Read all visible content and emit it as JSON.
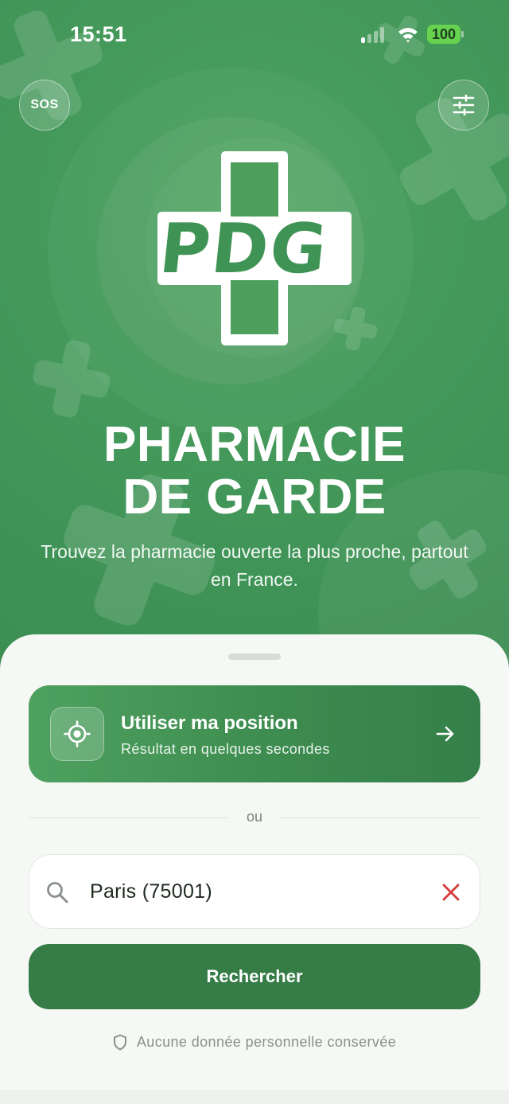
{
  "status_bar": {
    "time": "15:51",
    "battery": "100"
  },
  "header": {
    "sos_label": "SOS",
    "filter_icon": "sliders-icon"
  },
  "logo": {
    "text": "PDG",
    "shape": "cross-icon"
  },
  "hero": {
    "title_line1": "PHARMACIE",
    "title_line2": "DE GARDE",
    "subtitle": "Trouvez la pharmacie ouverte la plus proche, partout en France."
  },
  "location_card": {
    "title": "Utiliser ma position",
    "subtitle": "Résultat en quelques secondes",
    "icon": "crosshair-icon",
    "arrow_icon": "arrow-right-icon"
  },
  "separator_text": "ou",
  "search": {
    "value": "Paris (75001)",
    "icon": "search-icon",
    "clear_icon": "close-icon"
  },
  "search_button_label": "Rechercher",
  "privacy_note": "Aucune donnée personnelle conservée",
  "colors": {
    "primary": "#43985a",
    "button_dark": "#367c47",
    "clear_red": "#d63b3b"
  }
}
